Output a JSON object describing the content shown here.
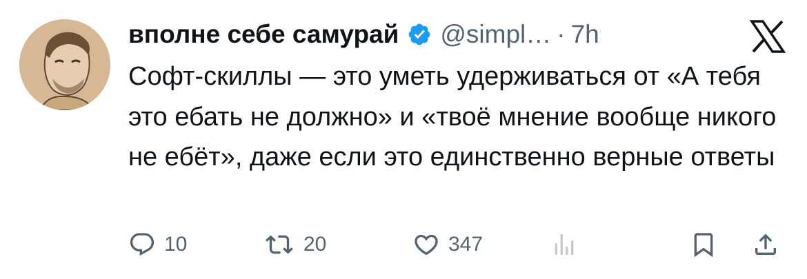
{
  "tweet": {
    "display_name": "вполне себе самурай",
    "handle": "@simpl…",
    "separator": "·",
    "time": "7h",
    "text": "Софт-скиллы — это уметь удерживаться от «А тебя это ебать не должно» и «твоё мнение вообще никого не ебёт», даже если это единственно верные ответы"
  },
  "actions": {
    "replies": "10",
    "retweets": "20",
    "likes": "347"
  },
  "icons": {
    "verified": "verified-badge-icon",
    "brand": "x-logo-icon",
    "reply": "reply-icon",
    "retweet": "retweet-icon",
    "like": "heart-icon",
    "views": "views-icon",
    "bookmark": "bookmark-icon",
    "share": "share-icon"
  },
  "colors": {
    "text": "#0f1419",
    "secondary": "#536471",
    "verified": "#1d9bf0",
    "avatar_bg": "#d8b894"
  }
}
